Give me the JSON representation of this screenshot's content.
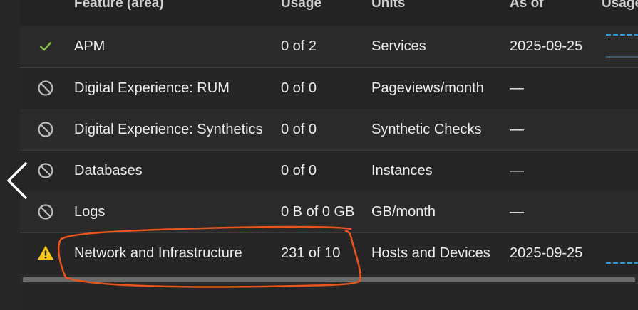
{
  "header": {
    "feature": "Feature (area)",
    "usage": "Usage",
    "units": "Units",
    "as_of": "As of",
    "usage_trend": "Usage"
  },
  "rows": [
    {
      "status_icon": "check-icon",
      "feature": "APM",
      "usage": "0 of 2",
      "units": "Services",
      "as_of": "2025-09-25",
      "has_trend": true
    },
    {
      "status_icon": "disabled-icon",
      "feature": "Digital Experience: RUM",
      "usage": "0 of 0",
      "units": "Pageviews/month",
      "as_of": "—",
      "has_trend": false
    },
    {
      "status_icon": "disabled-icon",
      "feature": "Digital Experience: Synthetics",
      "usage": "0 of 0",
      "units": "Synthetic Checks",
      "as_of": "—",
      "has_trend": false
    },
    {
      "status_icon": "disabled-icon",
      "feature": "Databases",
      "usage": "0 of 0",
      "units": "Instances",
      "as_of": "—",
      "has_trend": false
    },
    {
      "status_icon": "disabled-icon",
      "feature": "Logs",
      "usage": "0 B of 0 GB",
      "units": "GB/month",
      "as_of": "—",
      "has_trend": false
    },
    {
      "status_icon": "warning-icon",
      "feature": "Network and Infrastructure",
      "usage": "231 of 10",
      "units": "Hosts and Devices",
      "as_of": "2025-09-25",
      "has_trend": true
    }
  ],
  "colors": {
    "check": "#8bc34a",
    "warning": "#f5c518",
    "disabled": "#bdbdbd",
    "trend": "#2e9bd6",
    "annotation": "#e8541c"
  },
  "nav": {
    "previous_icon": "chevron-left-icon"
  }
}
